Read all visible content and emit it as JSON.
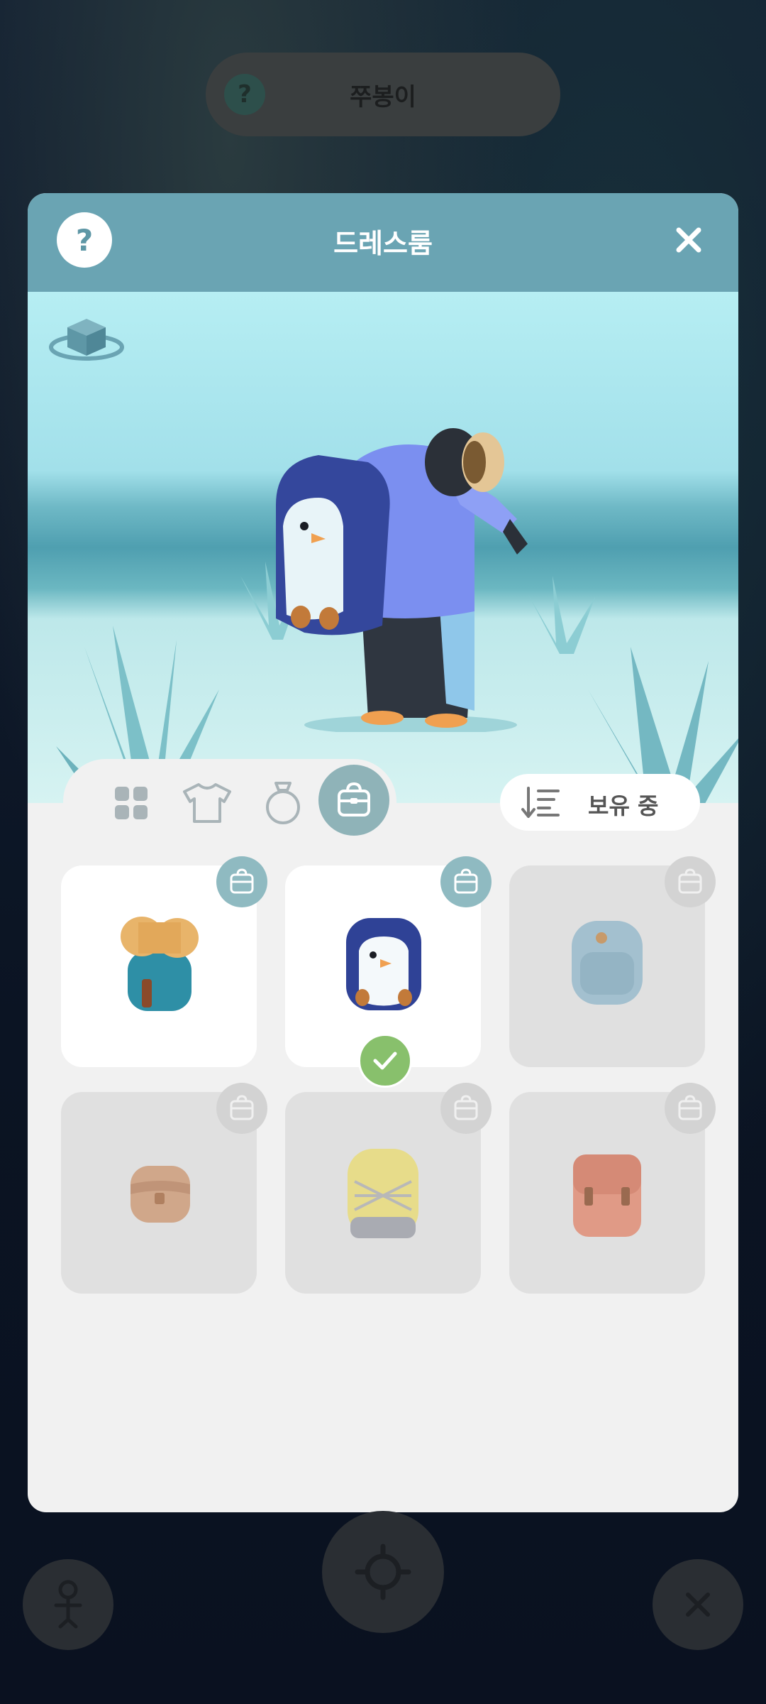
{
  "header_pill": {
    "help_label": "?",
    "name": "쭈봉이"
  },
  "dialog": {
    "title": "드레스룸",
    "help_label": "?",
    "close_label": "✕"
  },
  "tabs": [
    {
      "id": "all",
      "icon": "grid-icon"
    },
    {
      "id": "clothes",
      "icon": "shirt-icon"
    },
    {
      "id": "accessory",
      "icon": "ring-icon"
    },
    {
      "id": "bag",
      "icon": "bag-icon",
      "active": true
    }
  ],
  "sort": {
    "label": "보유 중",
    "icon": "sort-icon"
  },
  "items": [
    {
      "name": "bedroll-backpack",
      "owned": true,
      "equipped": false
    },
    {
      "name": "penguin-backpack",
      "owned": true,
      "equipped": true
    },
    {
      "name": "blue-backpack",
      "owned": false,
      "equipped": false
    },
    {
      "name": "brown-satchel",
      "owned": false,
      "equipped": false
    },
    {
      "name": "yellow-backpack",
      "owned": false,
      "equipped": false
    },
    {
      "name": "red-school-bag",
      "owned": false,
      "equipped": false
    }
  ],
  "colors": {
    "header": "#6aa4b3",
    "badge_owned": "#8fbac1",
    "equipped_check": "#88c06c"
  }
}
